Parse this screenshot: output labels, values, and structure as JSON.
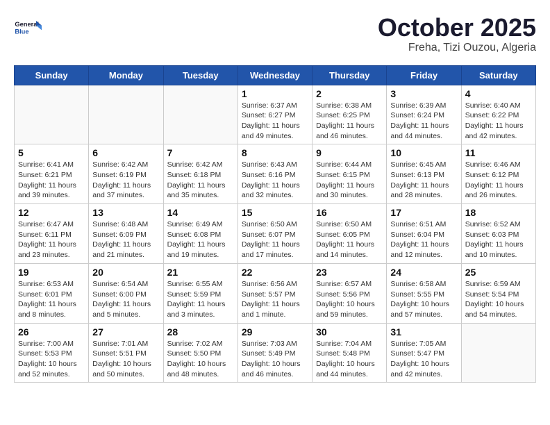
{
  "header": {
    "logo_general": "General",
    "logo_blue": "Blue",
    "month": "October 2025",
    "location": "Freha, Tizi Ouzou, Algeria"
  },
  "weekdays": [
    "Sunday",
    "Monday",
    "Tuesday",
    "Wednesday",
    "Thursday",
    "Friday",
    "Saturday"
  ],
  "weeks": [
    [
      {
        "day": "",
        "sunrise": "",
        "sunset": "",
        "daylight": ""
      },
      {
        "day": "",
        "sunrise": "",
        "sunset": "",
        "daylight": ""
      },
      {
        "day": "",
        "sunrise": "",
        "sunset": "",
        "daylight": ""
      },
      {
        "day": "1",
        "sunrise": "Sunrise: 6:37 AM",
        "sunset": "Sunset: 6:27 PM",
        "daylight": "Daylight: 11 hours and 49 minutes."
      },
      {
        "day": "2",
        "sunrise": "Sunrise: 6:38 AM",
        "sunset": "Sunset: 6:25 PM",
        "daylight": "Daylight: 11 hours and 46 minutes."
      },
      {
        "day": "3",
        "sunrise": "Sunrise: 6:39 AM",
        "sunset": "Sunset: 6:24 PM",
        "daylight": "Daylight: 11 hours and 44 minutes."
      },
      {
        "day": "4",
        "sunrise": "Sunrise: 6:40 AM",
        "sunset": "Sunset: 6:22 PM",
        "daylight": "Daylight: 11 hours and 42 minutes."
      }
    ],
    [
      {
        "day": "5",
        "sunrise": "Sunrise: 6:41 AM",
        "sunset": "Sunset: 6:21 PM",
        "daylight": "Daylight: 11 hours and 39 minutes."
      },
      {
        "day": "6",
        "sunrise": "Sunrise: 6:42 AM",
        "sunset": "Sunset: 6:19 PM",
        "daylight": "Daylight: 11 hours and 37 minutes."
      },
      {
        "day": "7",
        "sunrise": "Sunrise: 6:42 AM",
        "sunset": "Sunset: 6:18 PM",
        "daylight": "Daylight: 11 hours and 35 minutes."
      },
      {
        "day": "8",
        "sunrise": "Sunrise: 6:43 AM",
        "sunset": "Sunset: 6:16 PM",
        "daylight": "Daylight: 11 hours and 32 minutes."
      },
      {
        "day": "9",
        "sunrise": "Sunrise: 6:44 AM",
        "sunset": "Sunset: 6:15 PM",
        "daylight": "Daylight: 11 hours and 30 minutes."
      },
      {
        "day": "10",
        "sunrise": "Sunrise: 6:45 AM",
        "sunset": "Sunset: 6:13 PM",
        "daylight": "Daylight: 11 hours and 28 minutes."
      },
      {
        "day": "11",
        "sunrise": "Sunrise: 6:46 AM",
        "sunset": "Sunset: 6:12 PM",
        "daylight": "Daylight: 11 hours and 26 minutes."
      }
    ],
    [
      {
        "day": "12",
        "sunrise": "Sunrise: 6:47 AM",
        "sunset": "Sunset: 6:11 PM",
        "daylight": "Daylight: 11 hours and 23 minutes."
      },
      {
        "day": "13",
        "sunrise": "Sunrise: 6:48 AM",
        "sunset": "Sunset: 6:09 PM",
        "daylight": "Daylight: 11 hours and 21 minutes."
      },
      {
        "day": "14",
        "sunrise": "Sunrise: 6:49 AM",
        "sunset": "Sunset: 6:08 PM",
        "daylight": "Daylight: 11 hours and 19 minutes."
      },
      {
        "day": "15",
        "sunrise": "Sunrise: 6:50 AM",
        "sunset": "Sunset: 6:07 PM",
        "daylight": "Daylight: 11 hours and 17 minutes."
      },
      {
        "day": "16",
        "sunrise": "Sunrise: 6:50 AM",
        "sunset": "Sunset: 6:05 PM",
        "daylight": "Daylight: 11 hours and 14 minutes."
      },
      {
        "day": "17",
        "sunrise": "Sunrise: 6:51 AM",
        "sunset": "Sunset: 6:04 PM",
        "daylight": "Daylight: 11 hours and 12 minutes."
      },
      {
        "day": "18",
        "sunrise": "Sunrise: 6:52 AM",
        "sunset": "Sunset: 6:03 PM",
        "daylight": "Daylight: 11 hours and 10 minutes."
      }
    ],
    [
      {
        "day": "19",
        "sunrise": "Sunrise: 6:53 AM",
        "sunset": "Sunset: 6:01 PM",
        "daylight": "Daylight: 11 hours and 8 minutes."
      },
      {
        "day": "20",
        "sunrise": "Sunrise: 6:54 AM",
        "sunset": "Sunset: 6:00 PM",
        "daylight": "Daylight: 11 hours and 5 minutes."
      },
      {
        "day": "21",
        "sunrise": "Sunrise: 6:55 AM",
        "sunset": "Sunset: 5:59 PM",
        "daylight": "Daylight: 11 hours and 3 minutes."
      },
      {
        "day": "22",
        "sunrise": "Sunrise: 6:56 AM",
        "sunset": "Sunset: 5:57 PM",
        "daylight": "Daylight: 11 hours and 1 minute."
      },
      {
        "day": "23",
        "sunrise": "Sunrise: 6:57 AM",
        "sunset": "Sunset: 5:56 PM",
        "daylight": "Daylight: 10 hours and 59 minutes."
      },
      {
        "day": "24",
        "sunrise": "Sunrise: 6:58 AM",
        "sunset": "Sunset: 5:55 PM",
        "daylight": "Daylight: 10 hours and 57 minutes."
      },
      {
        "day": "25",
        "sunrise": "Sunrise: 6:59 AM",
        "sunset": "Sunset: 5:54 PM",
        "daylight": "Daylight: 10 hours and 54 minutes."
      }
    ],
    [
      {
        "day": "26",
        "sunrise": "Sunrise: 7:00 AM",
        "sunset": "Sunset: 5:53 PM",
        "daylight": "Daylight: 10 hours and 52 minutes."
      },
      {
        "day": "27",
        "sunrise": "Sunrise: 7:01 AM",
        "sunset": "Sunset: 5:51 PM",
        "daylight": "Daylight: 10 hours and 50 minutes."
      },
      {
        "day": "28",
        "sunrise": "Sunrise: 7:02 AM",
        "sunset": "Sunset: 5:50 PM",
        "daylight": "Daylight: 10 hours and 48 minutes."
      },
      {
        "day": "29",
        "sunrise": "Sunrise: 7:03 AM",
        "sunset": "Sunset: 5:49 PM",
        "daylight": "Daylight: 10 hours and 46 minutes."
      },
      {
        "day": "30",
        "sunrise": "Sunrise: 7:04 AM",
        "sunset": "Sunset: 5:48 PM",
        "daylight": "Daylight: 10 hours and 44 minutes."
      },
      {
        "day": "31",
        "sunrise": "Sunrise: 7:05 AM",
        "sunset": "Sunset: 5:47 PM",
        "daylight": "Daylight: 10 hours and 42 minutes."
      },
      {
        "day": "",
        "sunrise": "",
        "sunset": "",
        "daylight": ""
      }
    ]
  ]
}
